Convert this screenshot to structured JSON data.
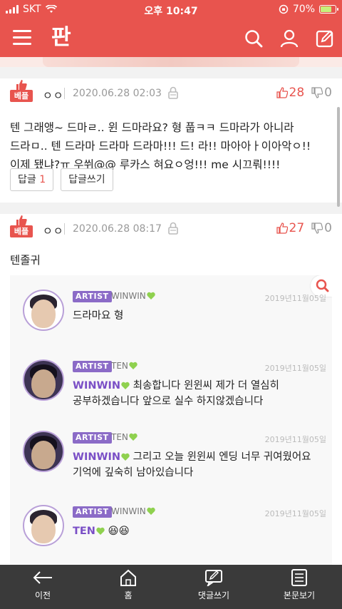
{
  "status_bar": {
    "carrier": "SKT",
    "time": "오후 10:47",
    "battery": "70%",
    "battery_level": 0.7
  },
  "app": {
    "logo": "판",
    "menu_icon": "hamburger-menu-icon",
    "search_icon": "search-icon",
    "profile_icon": "user-icon",
    "write_icon": "edit-icon",
    "accent_color": "#e8544e"
  },
  "comments": [
    {
      "badge": "베플",
      "author": "ㅇㅇ",
      "date": "2020.06.28 02:03",
      "up": "28",
      "down": "0",
      "text": "텐 그래앵~ 드마ㄹ.. 윈 드마라요? 형 풉ㅋㅋ 드마라가 아니라 드라ㅁ.. 텐 드라마 드라마 드라마!!! 드! 라!! 마아아ㅏ이아악ㅇ!! 이제 됐냐?ㅠ 우쒸@@ 루카스 혀요ㅇ엉!!! me 시끄뤄!!!!",
      "reply_label": "답글",
      "reply_count": "1",
      "write_reply_label": "답글쓰기"
    },
    {
      "badge": "베플",
      "author": "ㅇㅇ",
      "date": "2020.06.28 08:17",
      "up": "27",
      "down": "0",
      "text": "텐졸귀"
    }
  ],
  "embed": {
    "messages": [
      {
        "role": "ARTIST",
        "nick": "WINWIN",
        "date": "2019년11월05일",
        "mention": "",
        "text": "드라마요 형"
      },
      {
        "role": "ARTIST",
        "nick": "TEN",
        "date": "2019년11월05일",
        "mention": "WINWIN",
        "text": " 최송합니다 윈윈씨 제가 더 열심히 공부하겠습니다 앞으로 실수 하지않겠습니다"
      },
      {
        "role": "ARTIST",
        "nick": "TEN",
        "date": "2019년11월05일",
        "mention": "WINWIN",
        "text": " 그리고 오늘 윈윈씨 엔딩 너무 귀여웠어요 기억에 깊숙히 남아있습니다"
      },
      {
        "role": "ARTIST",
        "nick": "WINWIN",
        "date": "2019년11월05일",
        "mention": "TEN",
        "text": " 😆😆"
      }
    ]
  },
  "bottom_nav": {
    "items": [
      {
        "label": "이전",
        "icon": "back-arrow-icon"
      },
      {
        "label": "홈",
        "icon": "home-icon"
      },
      {
        "label": "댓글쓰기",
        "icon": "write-comment-icon"
      },
      {
        "label": "본문보기",
        "icon": "document-icon"
      }
    ]
  }
}
